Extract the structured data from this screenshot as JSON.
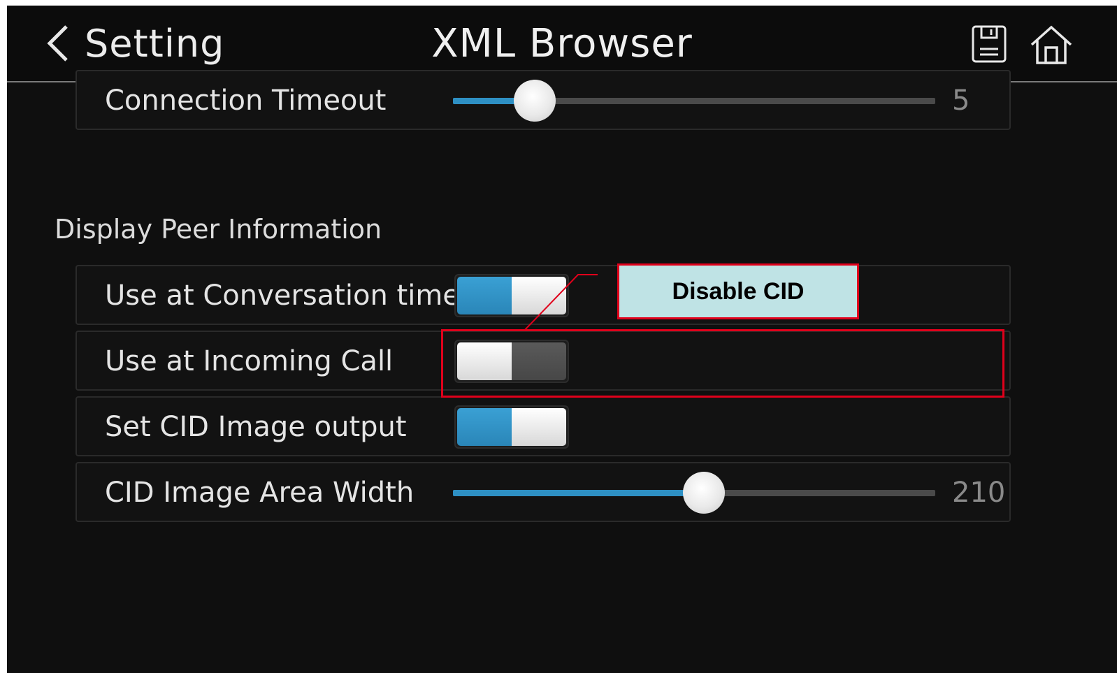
{
  "header": {
    "back_label": "Setting",
    "title": "XML Browser",
    "icons": [
      "chevron-left-icon",
      "save-icon",
      "home-icon"
    ]
  },
  "rows_top": [
    {
      "label": "Connection Timeout",
      "type": "slider",
      "value": "5",
      "fill_fraction": 0.17
    }
  ],
  "section": {
    "title": "Display Peer Information",
    "rows": [
      {
        "label": "Use at Conversation time",
        "type": "toggle",
        "state": "on"
      },
      {
        "label": "Use at Incoming Call",
        "type": "toggle",
        "state": "off"
      },
      {
        "label": "Set CID Image output",
        "type": "toggle",
        "state": "on"
      },
      {
        "label": "CID Image Area Width",
        "type": "slider",
        "value": "210",
        "fill_fraction": 0.52
      }
    ]
  },
  "annotation": {
    "callout_text": "Disable CID",
    "color": "#e0001b",
    "callout_bg": "#bfe3e5"
  },
  "colors": {
    "accent": "#2e90c4",
    "background": "#0f0f0f"
  }
}
